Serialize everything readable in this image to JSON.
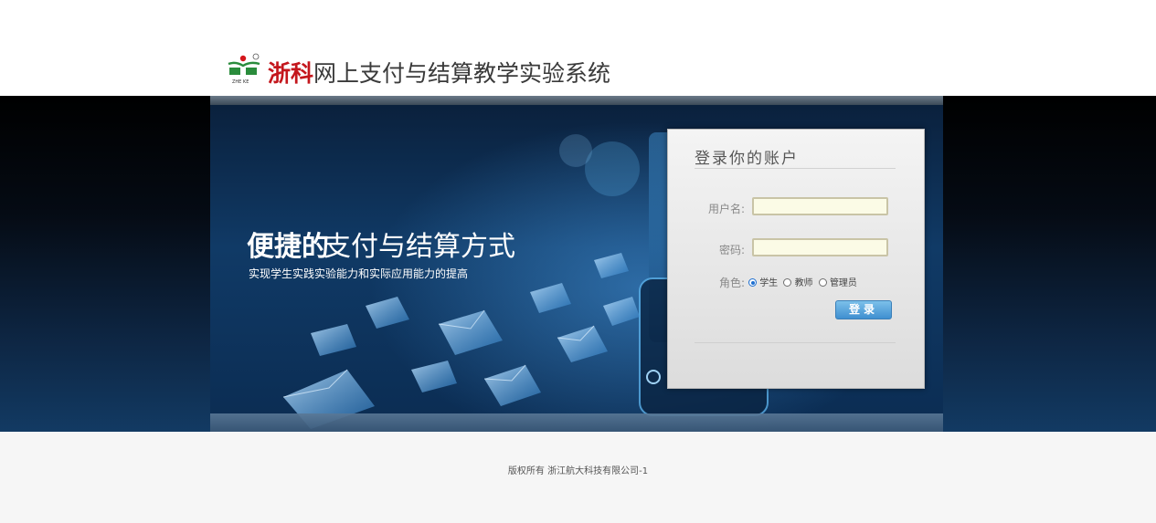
{
  "header": {
    "brand": "浙科",
    "system_title": "网上支付与结算教学实验系统",
    "logo_caption": "ZHE KE"
  },
  "banner": {
    "slogan_bold": "便捷的",
    "slogan_rest": "支付与结算方式",
    "subtitle": "实现学生实践实验能力和实际应用能力的提高"
  },
  "login": {
    "heading": "登录你的账户",
    "username_label": "用户名:",
    "username_value": "",
    "password_label": "密码:",
    "password_value": "",
    "role_label": "角色:",
    "roles": [
      "学生",
      "教师",
      "管理员"
    ],
    "selected_role": "学生",
    "submit_label": "登录"
  },
  "footer": {
    "copyright": "版权所有   浙江航大科技有限公司-1"
  },
  "colors": {
    "brand_red": "#c4161c",
    "button_blue": "#3f8fd0",
    "input_bg": "#fbfbe6"
  }
}
